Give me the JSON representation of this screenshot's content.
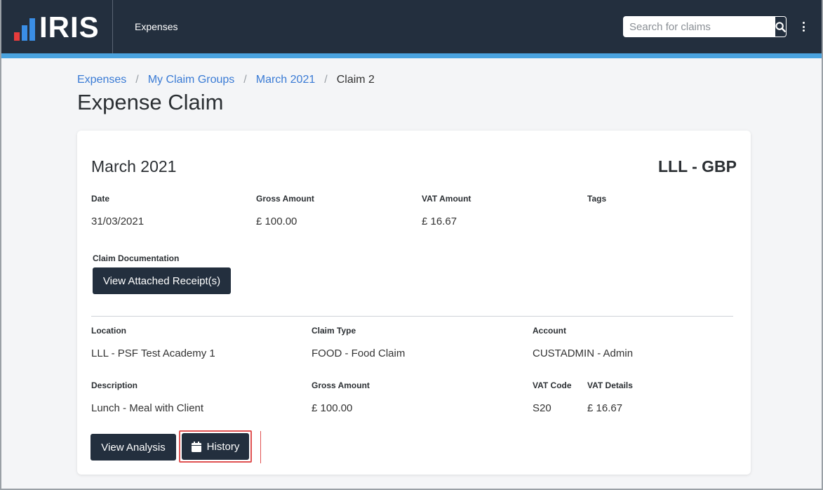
{
  "header": {
    "logo_text": "IRIS",
    "nav_title": "Expenses",
    "search": {
      "placeholder": "Search for claims",
      "value": ""
    }
  },
  "breadcrumb": {
    "items": [
      "Expenses",
      "My Claim Groups",
      "March 2021"
    ],
    "current": "Claim 2"
  },
  "page": {
    "title": "Expense Claim"
  },
  "card": {
    "heading": "March 2021",
    "currency": "LLL - GBP",
    "summary": {
      "date_label": "Date",
      "date_value": "31/03/2021",
      "gross_label": "Gross Amount",
      "gross_value": "£ 100.00",
      "vat_label": "VAT Amount",
      "vat_value": "£ 16.67",
      "tags_label": "Tags"
    },
    "documentation": {
      "label": "Claim Documentation",
      "button_label": "View Attached Receipt(s)"
    },
    "line": {
      "location_label": "Location",
      "location_value": "LLL - PSF Test Academy 1",
      "claim_type_label": "Claim Type",
      "claim_type_value": "FOOD - Food Claim",
      "account_label": "Account",
      "account_value": "CUSTADMIN - Admin",
      "description_label": "Description",
      "description_value": "Lunch - Meal with Client",
      "gross_label": "Gross Amount",
      "gross_value": "£ 100.00",
      "vat_code_label": "VAT Code",
      "vat_code_value": "S20",
      "vat_details_label": "VAT Details",
      "vat_details_value": "£ 16.67"
    },
    "actions": {
      "view_analysis_label": "View Analysis",
      "history_label": "History"
    }
  },
  "colors": {
    "topbar": "#232f3e",
    "accent": "#4aa3df",
    "link": "#3a7bd5",
    "highlight": "#e05252"
  },
  "icons": {
    "search": "search-icon",
    "menu": "kebab-menu-icon",
    "history": "calendar-icon"
  }
}
